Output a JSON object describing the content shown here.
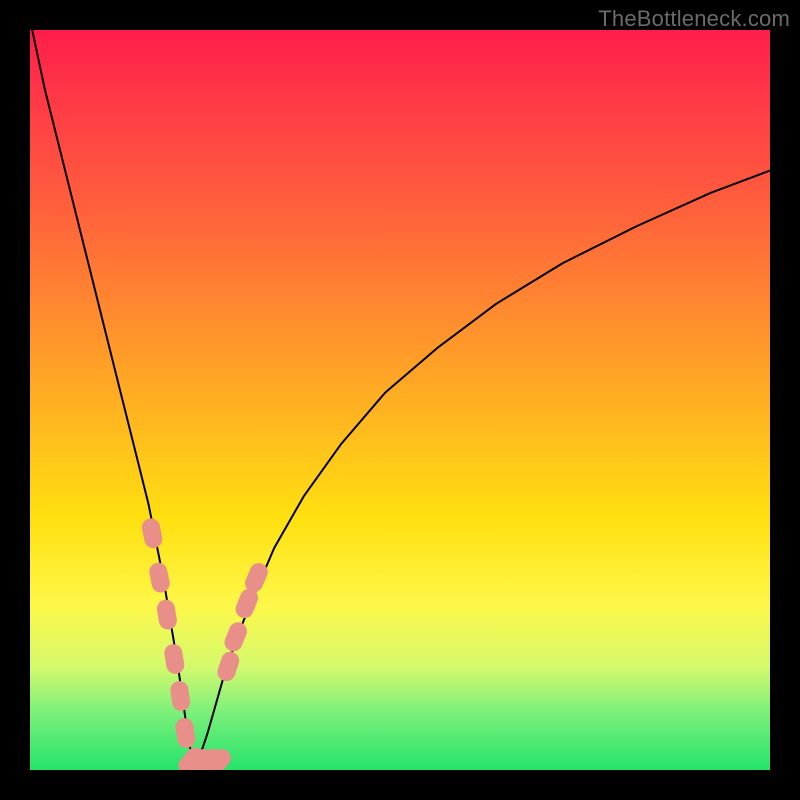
{
  "watermark": "TheBottleneck.com",
  "colors": {
    "curve_stroke": "#000000",
    "marker_fill": "#e88f8a",
    "background_black": "#000000"
  },
  "chart_data": {
    "type": "line",
    "title": "",
    "xlabel": "",
    "ylabel": "",
    "xlim": [
      0,
      100
    ],
    "ylim": [
      0,
      100
    ],
    "grid": false,
    "legend": false,
    "curve_description": "V-shaped bottleneck curve with minimum near x≈22; asymmetric — left branch nearly vertical, right branch rises toward ~80% on the right",
    "x": [
      0.3,
      2,
      4,
      6,
      8,
      10,
      12,
      14,
      16,
      17,
      18,
      19,
      20,
      21,
      22,
      23,
      24,
      25,
      26,
      28,
      30,
      33,
      37,
      42,
      48,
      55,
      63,
      72,
      82,
      92,
      100
    ],
    "y": [
      100,
      92,
      84,
      76,
      68,
      60,
      52,
      44,
      36,
      31,
      26,
      20,
      14,
      7,
      0.8,
      2,
      5,
      8.5,
      12,
      18,
      23,
      30,
      37,
      44,
      51,
      57,
      63,
      68.5,
      73.5,
      78,
      81
    ],
    "markers": [
      {
        "x": 16.5,
        "y": 32
      },
      {
        "x": 17.5,
        "y": 26
      },
      {
        "x": 18.5,
        "y": 21
      },
      {
        "x": 19.5,
        "y": 15
      },
      {
        "x": 20.3,
        "y": 10
      },
      {
        "x": 21.0,
        "y": 5
      },
      {
        "x": 21.8,
        "y": 1.2
      },
      {
        "x": 23.0,
        "y": 1.0
      },
      {
        "x": 24.2,
        "y": 1.0
      },
      {
        "x": 25.4,
        "y": 1.0
      },
      {
        "x": 26.8,
        "y": 14
      },
      {
        "x": 27.8,
        "y": 18
      },
      {
        "x": 29.3,
        "y": 22.5
      },
      {
        "x": 30.6,
        "y": 26
      }
    ]
  }
}
